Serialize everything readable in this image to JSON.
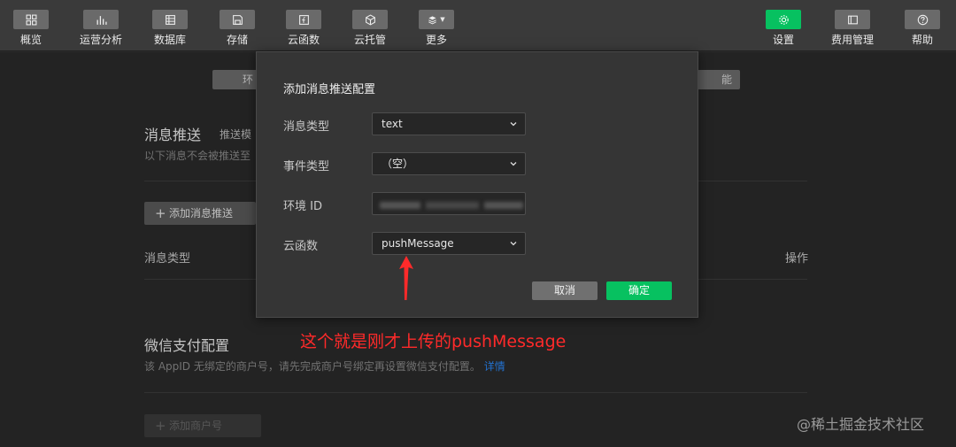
{
  "toolbar": {
    "items": [
      {
        "label": "概览",
        "icon": "grid-icon"
      },
      {
        "label": "运营分析",
        "icon": "bar-chart-icon"
      },
      {
        "label": "数据库",
        "icon": "database-icon"
      },
      {
        "label": "存储",
        "icon": "floppy-icon"
      },
      {
        "label": "云函数",
        "icon": "function-icon"
      },
      {
        "label": "云托管",
        "icon": "cube-icon"
      },
      {
        "label": "更多",
        "icon": "layers-dropdown-icon"
      },
      {
        "label": "设置",
        "icon": "gear-icon",
        "active": true
      },
      {
        "label": "费用管理",
        "icon": "billing-icon"
      },
      {
        "label": "帮助",
        "icon": "help-icon"
      }
    ]
  },
  "page": {
    "env_tab_left": "环",
    "env_tab_right": "能",
    "push": {
      "title": "消息推送",
      "subtitle": "推送模",
      "desc": "以下消息不会被推送至",
      "add_button": "添加消息推送",
      "col_type": "消息类型",
      "col_action": "操作"
    },
    "pay": {
      "title": "微信支付配置",
      "desc": "该 AppID 无绑定的商户号，请先完成商户号绑定再设置微信支付配置。",
      "link": "详情",
      "add_button": "添加商户号"
    }
  },
  "dialog": {
    "title": "添加消息推送配置",
    "fields": {
      "msg_type": {
        "label": "消息类型",
        "value": "text"
      },
      "event_type": {
        "label": "事件类型",
        "value": "（空）"
      },
      "env_id": {
        "label": "环境 ID",
        "value": ""
      },
      "cloud_fn": {
        "label": "云函数",
        "value": "pushMessage"
      }
    },
    "cancel": "取消",
    "confirm": "确定"
  },
  "annotation": {
    "text": "这个就是刚才上传的pushMessage",
    "color": "#ff2a2a"
  },
  "watermark": "@稀土掘金技术社区",
  "colors": {
    "accent": "#07c160",
    "link": "#2b8cff"
  }
}
